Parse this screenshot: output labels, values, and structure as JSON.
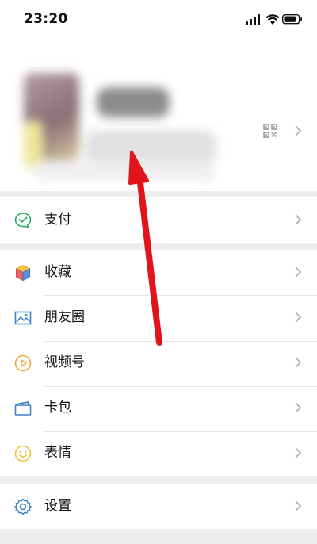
{
  "status_bar": {
    "time": "23:20"
  },
  "menu": {
    "pay": {
      "label": "支付"
    },
    "favorites": {
      "label": "收藏"
    },
    "moments": {
      "label": "朋友圈"
    },
    "channels": {
      "label": "视频号"
    },
    "cards": {
      "label": "卡包"
    },
    "stickers": {
      "label": "表情"
    },
    "settings": {
      "label": "设置"
    }
  },
  "colors": {
    "accent_green": "#2aae67",
    "arrow_red": "#e0141a",
    "icon_blue": "#3d82c4",
    "icon_orange": "#f0a43b",
    "icon_yellow": "#f2c13b"
  }
}
